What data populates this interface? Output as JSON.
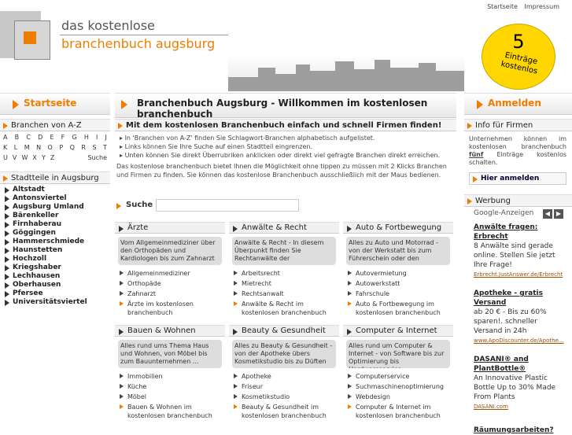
{
  "header": {
    "logo_line1": "das kostenlose",
    "logo_line2": "branchenbuch augsburg",
    "nav": [
      "Startseite",
      "Impressum"
    ],
    "badge_number": "5",
    "badge_text": "Einträge kostenlos"
  },
  "left": {
    "start_label": "Startseite",
    "branchen_title": "Branchen von A-Z",
    "az_rows": [
      [
        "A",
        "B",
        "C",
        "D",
        "E",
        "F",
        "G",
        "H",
        "I",
        "J"
      ],
      [
        "K",
        "L",
        "M",
        "N",
        "O",
        "P",
        "Q",
        "R",
        "S",
        "T"
      ],
      [
        "U",
        "V",
        "W",
        "X",
        "Y",
        "Z",
        "",
        "",
        "Suche"
      ]
    ],
    "stadtteile_title": "Stadtteile in Augsburg",
    "districts": [
      "Altstadt",
      "Antonsviertel",
      "Augsburg Umland",
      "Bärenkeller",
      "Firnhaberau",
      "Göggingen",
      "Hammerschmiede",
      "Haunstetten",
      "Hochzoll",
      "Kriegshaber",
      "Lechhausen",
      "Oberhausen",
      "Pfersee",
      "Universitätsviertel"
    ]
  },
  "main": {
    "title": "Branchenbuch Augsburg - Willkommen im kostenlosen branchenbuch",
    "subtitle": "Mit dem kostenlosen Branchenbuch einfach und schnell Firmen finden!",
    "bullet1": "In 'Branchen von A-Z' finden Sie Schlagwort-Branchen alphabetisch aufgelistet.",
    "bullet2": "Links können Sie Ihre Suche auf einen Stadtteil eingrenzen.",
    "bullet3": "Unten können Sie direkt Überrubriken anklicken oder direkt viel gefragte Branchen direkt erreichen.",
    "paragraph": "Das kostenlose branchenbuch bietet Ihnen die Möglichkeit ohne tippen zu müssen mit 2 Klicks Branchen und Firmen zu finden. Sie können das kostenlose Branchenbuch ausschließlich mit der Maus bedienen.",
    "search_label": "Suche",
    "categories": [
      {
        "title": "Ärzte",
        "desc": "Vom Allgemeinmediziner über den Orthopäden und Kardiologen bis zum Zahnarzt",
        "items": [
          "Allgemeinmediziner",
          "Orthopäde",
          "Zahnarzt",
          "Ärzte im kostenlosen branchenbuch"
        ]
      },
      {
        "title": "Anwälte & Recht",
        "desc": "Anwälte & Recht - In diesem Überpunkt finden Sie Rechtanwälte der",
        "items": [
          "Arbeitsrecht",
          "Mietrecht",
          "Rechtsanwalt",
          "Anwälte & Recht im kostenlosen branchenbuch"
        ]
      },
      {
        "title": "Auto & Fortbewegung",
        "desc": "Alles zu Auto und Motorrad - von der Werkstatt bis zum Führerschein oder den",
        "items": [
          "Autovermietung",
          "Autowerkstatt",
          "Fahrschule",
          "Auto & Fortbewegung im kostenlosen branchenbuch"
        ]
      },
      {
        "title": "Bauen & Wohnen",
        "desc": "Alles rund ums Thema Haus und Wohnen, von Möbel bis zum Bauunternehmen ...",
        "items": [
          "Immobilien",
          "Küche",
          "Möbel",
          "Bauen & Wohnen im kostenlosen branchenbuch"
        ]
      },
      {
        "title": "Beauty & Gesundheit",
        "desc": "Alles zu Beauty & Gesundheit - von der Apotheke übers Kosmetikstudio bis zu Düften",
        "items": [
          "Apotheke",
          "Friseur",
          "Kosmetikstudio",
          "Beauty & Gesundheit im kostenlosen branchenbuch"
        ]
      },
      {
        "title": "Computer & Internet",
        "desc": "Alles rund um Computer & Internet - von Software bis zur Optimierung bis Hardwareservice ...",
        "items": [
          "Computerservice",
          "Suchmaschinenoptimierung",
          "Webdesign",
          "Computer & Internet im kostenlosen branchenbuch"
        ]
      }
    ]
  },
  "right": {
    "login_label": "Anmelden",
    "info_title": "Info für Firmen",
    "info_text_1": "Unternehmen können im kostenlosen branchenbuch",
    "info_text_bold": "fünf",
    "info_text_2": "Einträge kostenlos schalten.",
    "info_button": "Hier anmelden",
    "werbung_title": "Werbung",
    "google_label": "Google-Anzeigen",
    "ads": [
      {
        "title": "Anwälte fragen: Erbrecht",
        "body": "8 Anwälte sind gerade online. Stellen Sie jetzt Ihre Frage!",
        "url": "Erbrecht.JustAnswer.de/Erbrecht"
      },
      {
        "title": "Apotheke - gratis Versand",
        "body": "ab 20 € - Bis zu 60% sparen!. schneller Versand in 24h",
        "url": "www.ApoDiscounter.de/Apothe..."
      },
      {
        "title": "DASANI® and PlantBottle®",
        "body": "An Innovative Plastic Bottle Up to 30% Made From Plants",
        "url": "DASANI.com"
      },
      {
        "title": "Räumungsarbeiten?",
        "body": "",
        "url": ""
      }
    ]
  }
}
